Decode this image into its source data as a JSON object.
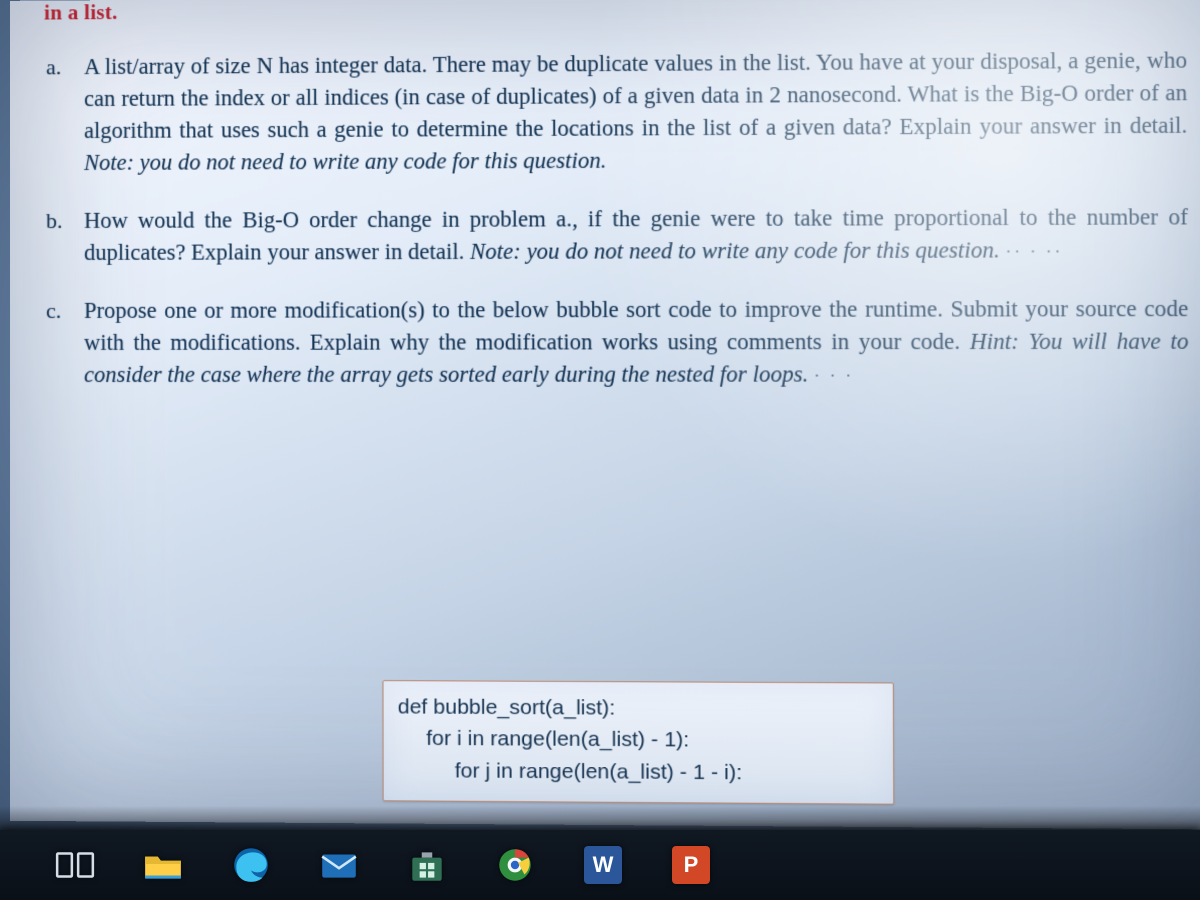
{
  "header_fragment": "in a list.",
  "questions": {
    "a": {
      "marker": "a.",
      "body": "A list/array of size N has integer data. There may be duplicate values in the list. You have at your disposal, a genie, who can return the index or all indices (in case of duplicates) of a given data in 2 nanosecond. What is the Big-O order of an algorithm that uses such a genie to determine the locations in the list of a given data? Explain your answer in detail.",
      "note": "Note: you do not need to write any code for this question."
    },
    "b": {
      "marker": "b.",
      "body": "How would the Big-O order change in problem a., if the genie were to take time proportional to the number of duplicates? Explain your answer in detail. ",
      "note": "Note: you do not need to write any code for this question."
    },
    "c": {
      "marker": "c.",
      "body": "Propose one or more modification(s) to the below bubble sort code to improve the runtime. Submit your source code with the modifications. Explain why the modification works using comments in your code.  ",
      "hint": "Hint: You will have to consider the case where the array gets sorted early during the nested for loops."
    }
  },
  "code": {
    "line1": "def bubble_sort(a_list):",
    "line2": "for i in range(len(a_list) - 1):",
    "line3": "for j in range(len(a_list) - 1 - i):"
  },
  "taskbar": {
    "icons": [
      "task-view-icon",
      "file-explorer-icon",
      "edge-icon",
      "mail-icon",
      "store-icon",
      "browser-icon",
      "word-icon",
      "powerpoint-icon"
    ],
    "word_letter": "W",
    "powerpoint_letter": "P"
  }
}
